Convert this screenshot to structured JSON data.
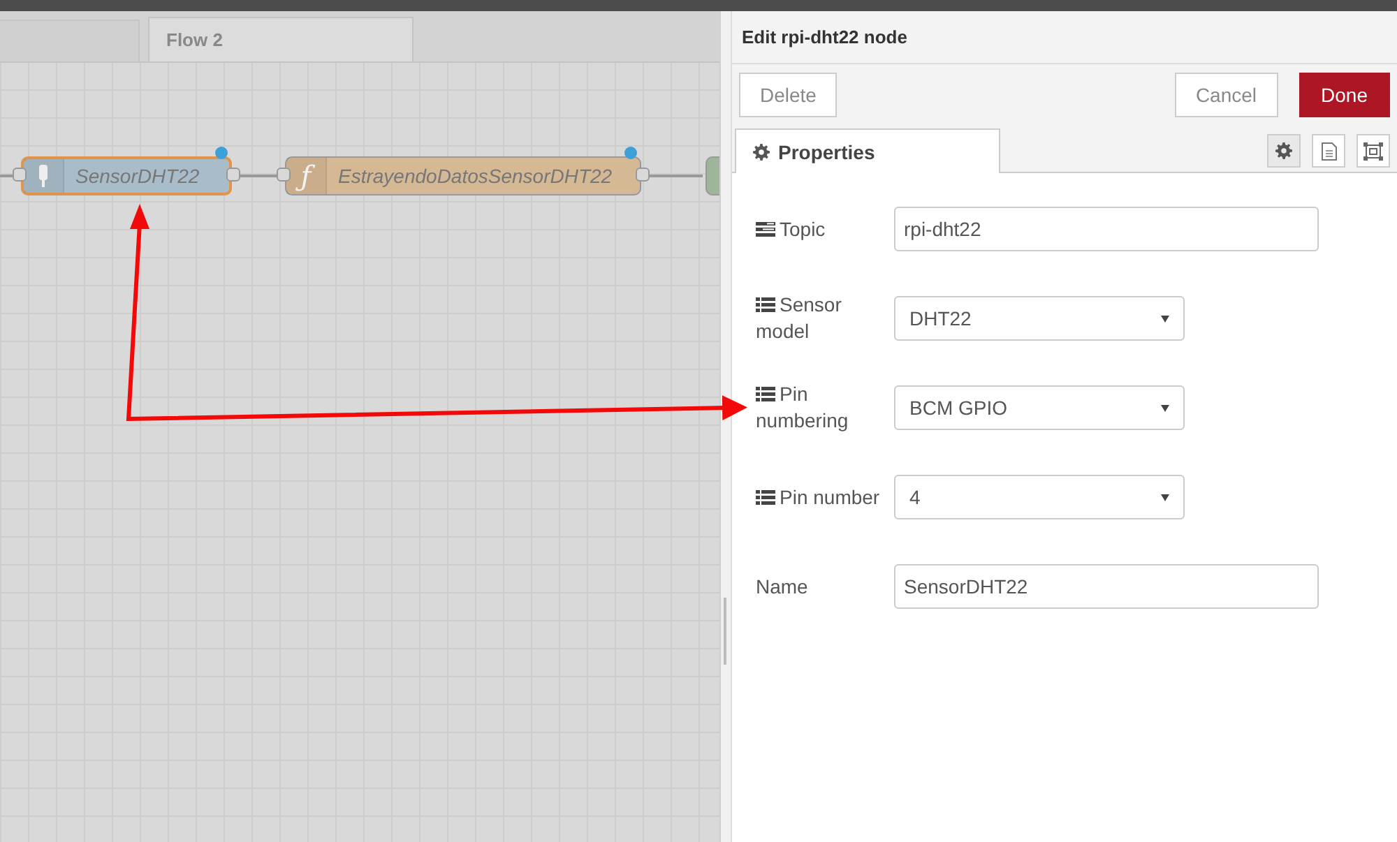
{
  "workspace": {
    "tabs": [
      {
        "label": "Flow 2",
        "selected": true
      }
    ],
    "nodes": [
      {
        "label": "SensorDHT22",
        "kind": "sensor",
        "selected": true,
        "changed": true
      },
      {
        "label": "EstrayendoDatosSensorDHT22",
        "kind": "function",
        "symbol": "ƒ",
        "selected": false,
        "changed": true
      }
    ]
  },
  "editor": {
    "title": "Edit rpi-dht22 node",
    "buttons": [
      {
        "label": "Delete",
        "kind": "plain"
      },
      {
        "label": "Cancel",
        "kind": "plain"
      },
      {
        "label": "Done",
        "kind": "primary"
      }
    ],
    "tabs": [
      {
        "label": "Properties",
        "selected": true
      }
    ],
    "fields": [
      {
        "label": "Topic",
        "kind": "text",
        "value": "rpi-dht22"
      },
      {
        "label": "Sensor model",
        "kind": "select",
        "value": "DHT22"
      },
      {
        "label": "Pin numbering",
        "kind": "select",
        "value": "BCM GPIO"
      },
      {
        "label": "Pin number",
        "kind": "select",
        "value": "4"
      },
      {
        "label": "Name",
        "kind": "text",
        "value": "SensorDHT22"
      }
    ]
  }
}
